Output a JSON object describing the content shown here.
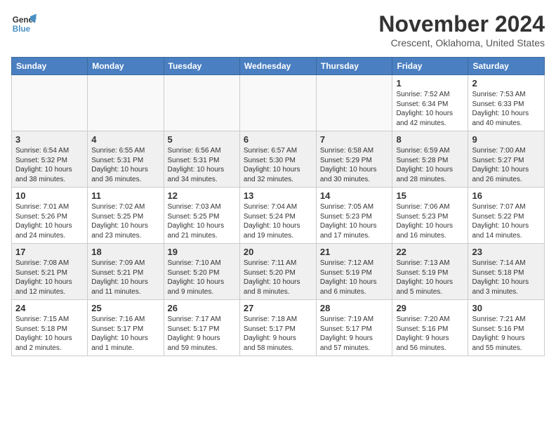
{
  "logo": {
    "line1": "General",
    "line2": "Blue"
  },
  "header": {
    "month": "November 2024",
    "location": "Crescent, Oklahoma, United States"
  },
  "weekdays": [
    "Sunday",
    "Monday",
    "Tuesday",
    "Wednesday",
    "Thursday",
    "Friday",
    "Saturday"
  ],
  "rows": [
    [
      {
        "day": "",
        "info": ""
      },
      {
        "day": "",
        "info": ""
      },
      {
        "day": "",
        "info": ""
      },
      {
        "day": "",
        "info": ""
      },
      {
        "day": "",
        "info": ""
      },
      {
        "day": "1",
        "info": "Sunrise: 7:52 AM\nSunset: 6:34 PM\nDaylight: 10 hours\nand 42 minutes."
      },
      {
        "day": "2",
        "info": "Sunrise: 7:53 AM\nSunset: 6:33 PM\nDaylight: 10 hours\nand 40 minutes."
      }
    ],
    [
      {
        "day": "3",
        "info": "Sunrise: 6:54 AM\nSunset: 5:32 PM\nDaylight: 10 hours\nand 38 minutes."
      },
      {
        "day": "4",
        "info": "Sunrise: 6:55 AM\nSunset: 5:31 PM\nDaylight: 10 hours\nand 36 minutes."
      },
      {
        "day": "5",
        "info": "Sunrise: 6:56 AM\nSunset: 5:31 PM\nDaylight: 10 hours\nand 34 minutes."
      },
      {
        "day": "6",
        "info": "Sunrise: 6:57 AM\nSunset: 5:30 PM\nDaylight: 10 hours\nand 32 minutes."
      },
      {
        "day": "7",
        "info": "Sunrise: 6:58 AM\nSunset: 5:29 PM\nDaylight: 10 hours\nand 30 minutes."
      },
      {
        "day": "8",
        "info": "Sunrise: 6:59 AM\nSunset: 5:28 PM\nDaylight: 10 hours\nand 28 minutes."
      },
      {
        "day": "9",
        "info": "Sunrise: 7:00 AM\nSunset: 5:27 PM\nDaylight: 10 hours\nand 26 minutes."
      }
    ],
    [
      {
        "day": "10",
        "info": "Sunrise: 7:01 AM\nSunset: 5:26 PM\nDaylight: 10 hours\nand 24 minutes."
      },
      {
        "day": "11",
        "info": "Sunrise: 7:02 AM\nSunset: 5:25 PM\nDaylight: 10 hours\nand 23 minutes."
      },
      {
        "day": "12",
        "info": "Sunrise: 7:03 AM\nSunset: 5:25 PM\nDaylight: 10 hours\nand 21 minutes."
      },
      {
        "day": "13",
        "info": "Sunrise: 7:04 AM\nSunset: 5:24 PM\nDaylight: 10 hours\nand 19 minutes."
      },
      {
        "day": "14",
        "info": "Sunrise: 7:05 AM\nSunset: 5:23 PM\nDaylight: 10 hours\nand 17 minutes."
      },
      {
        "day": "15",
        "info": "Sunrise: 7:06 AM\nSunset: 5:23 PM\nDaylight: 10 hours\nand 16 minutes."
      },
      {
        "day": "16",
        "info": "Sunrise: 7:07 AM\nSunset: 5:22 PM\nDaylight: 10 hours\nand 14 minutes."
      }
    ],
    [
      {
        "day": "17",
        "info": "Sunrise: 7:08 AM\nSunset: 5:21 PM\nDaylight: 10 hours\nand 12 minutes."
      },
      {
        "day": "18",
        "info": "Sunrise: 7:09 AM\nSunset: 5:21 PM\nDaylight: 10 hours\nand 11 minutes."
      },
      {
        "day": "19",
        "info": "Sunrise: 7:10 AM\nSunset: 5:20 PM\nDaylight: 10 hours\nand 9 minutes."
      },
      {
        "day": "20",
        "info": "Sunrise: 7:11 AM\nSunset: 5:20 PM\nDaylight: 10 hours\nand 8 minutes."
      },
      {
        "day": "21",
        "info": "Sunrise: 7:12 AM\nSunset: 5:19 PM\nDaylight: 10 hours\nand 6 minutes."
      },
      {
        "day": "22",
        "info": "Sunrise: 7:13 AM\nSunset: 5:19 PM\nDaylight: 10 hours\nand 5 minutes."
      },
      {
        "day": "23",
        "info": "Sunrise: 7:14 AM\nSunset: 5:18 PM\nDaylight: 10 hours\nand 3 minutes."
      }
    ],
    [
      {
        "day": "24",
        "info": "Sunrise: 7:15 AM\nSunset: 5:18 PM\nDaylight: 10 hours\nand 2 minutes."
      },
      {
        "day": "25",
        "info": "Sunrise: 7:16 AM\nSunset: 5:17 PM\nDaylight: 10 hours\nand 1 minute."
      },
      {
        "day": "26",
        "info": "Sunrise: 7:17 AM\nSunset: 5:17 PM\nDaylight: 9 hours\nand 59 minutes."
      },
      {
        "day": "27",
        "info": "Sunrise: 7:18 AM\nSunset: 5:17 PM\nDaylight: 9 hours\nand 58 minutes."
      },
      {
        "day": "28",
        "info": "Sunrise: 7:19 AM\nSunset: 5:17 PM\nDaylight: 9 hours\nand 57 minutes."
      },
      {
        "day": "29",
        "info": "Sunrise: 7:20 AM\nSunset: 5:16 PM\nDaylight: 9 hours\nand 56 minutes."
      },
      {
        "day": "30",
        "info": "Sunrise: 7:21 AM\nSunset: 5:16 PM\nDaylight: 9 hours\nand 55 minutes."
      }
    ]
  ]
}
